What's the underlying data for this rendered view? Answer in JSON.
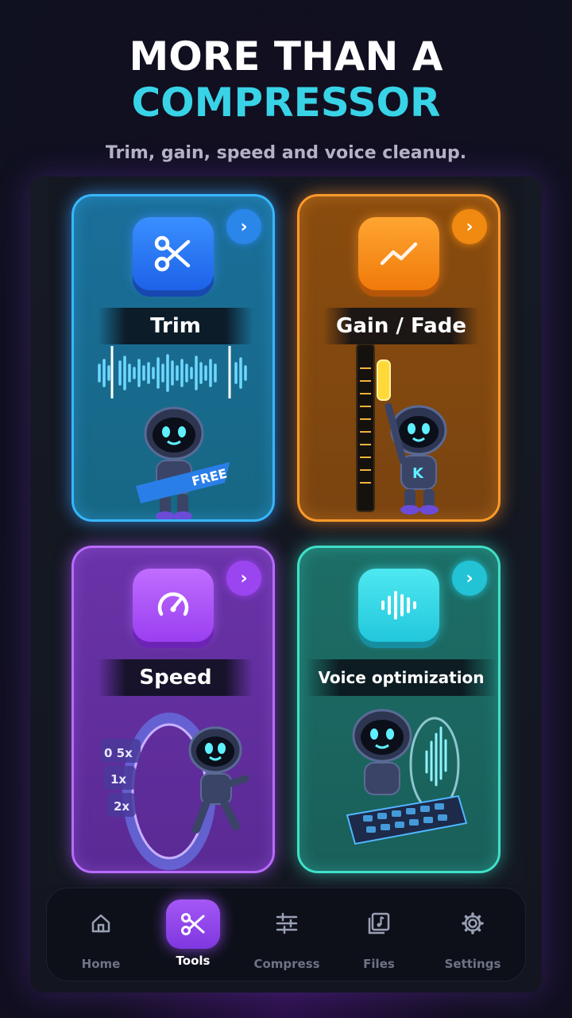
{
  "header": {
    "title_line1": "MORE THAN A",
    "title_line2": "COMPRESSOR",
    "subtitle": "Trim, gain, speed and voice cleanup."
  },
  "colors": {
    "accent_cyan": "#38d3e6",
    "trim": "#38b6ff",
    "gain": "#ff9a2a",
    "speed": "#b86bff",
    "voice": "#40e0c8"
  },
  "cards": [
    {
      "id": "trim",
      "label": "Trim",
      "icon": "scissors-icon",
      "badge": "FREE"
    },
    {
      "id": "gain",
      "label": "Gain / Fade",
      "icon": "trend-up-icon"
    },
    {
      "id": "speed",
      "label": "Speed",
      "icon": "speedometer-icon",
      "speeds": [
        "0 5x",
        "1x",
        "2x"
      ]
    },
    {
      "id": "voice",
      "label": "Voice optimization",
      "icon": "waveform-icon"
    }
  ],
  "nav": {
    "items": [
      {
        "label": "Home",
        "icon": "home-icon"
      },
      {
        "label": "Tools",
        "icon": "scissors-icon",
        "active": true
      },
      {
        "label": "Compress",
        "icon": "sliders-icon"
      },
      {
        "label": "Files",
        "icon": "music-file-icon"
      },
      {
        "label": "Settings",
        "icon": "gear-icon"
      }
    ]
  }
}
